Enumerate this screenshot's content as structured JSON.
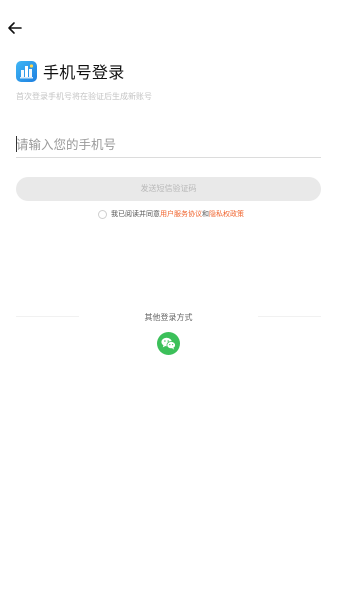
{
  "header": {
    "back_icon": "arrow-left-icon",
    "logo_icon": "app-logo-icon",
    "title": "手机号登录",
    "subtitle": "首次登录手机号将在验证后生成新账号"
  },
  "form": {
    "phone_placeholder": "请输入您的手机号",
    "phone_value": "",
    "send_code_label": "发送短信验证码"
  },
  "agreement": {
    "prefix": "我已阅读并同意",
    "user_agreement": "用户服务协议",
    "and": "和",
    "privacy_policy": "隐私权政策",
    "checked": false
  },
  "other_login": {
    "label": "其他登录方式",
    "wechat_icon": "wechat-icon"
  },
  "colors": {
    "link": "#f0642e",
    "wechat": "#3cc05a",
    "logo": "#2a9aeb",
    "button_bg": "#e9e9e9"
  }
}
